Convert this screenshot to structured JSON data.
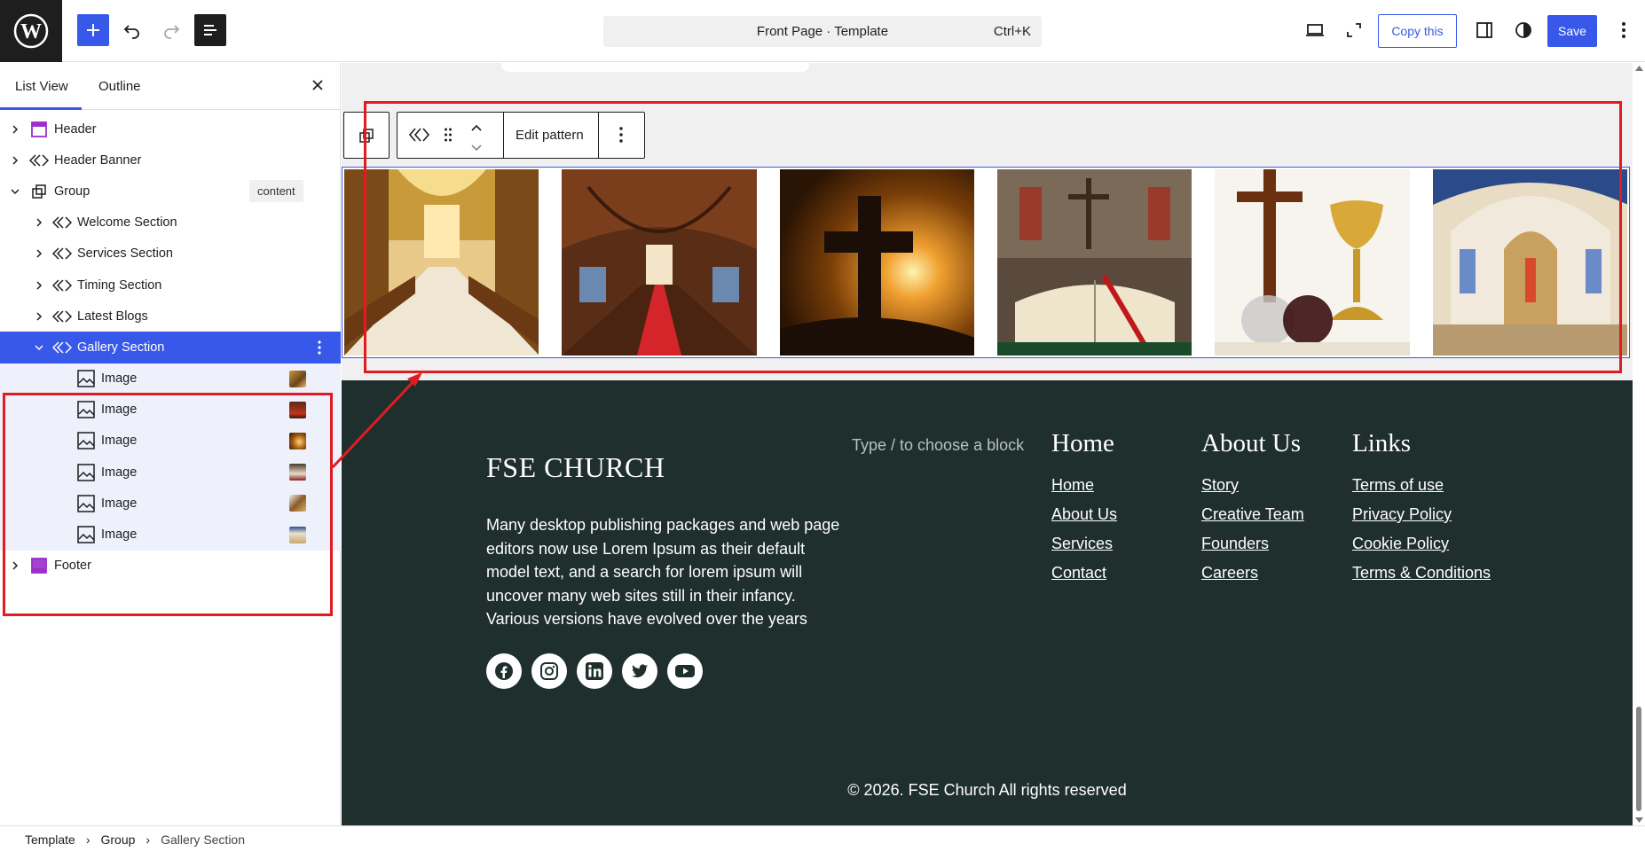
{
  "topbar": {
    "command_title": "Front Page · Template",
    "command_shortcut": "Ctrl+K",
    "copy_label": "Copy this",
    "save_label": "Save"
  },
  "left_panel": {
    "tabs": [
      "List View",
      "Outline"
    ],
    "tree": [
      {
        "label": "Header"
      },
      {
        "label": "Header Banner"
      },
      {
        "label": "Group",
        "badge": "content"
      },
      {
        "label": "Welcome Section"
      },
      {
        "label": "Services Section"
      },
      {
        "label": "Timing Section"
      },
      {
        "label": "Latest Blogs"
      },
      {
        "label": "Gallery Section"
      },
      {
        "label": "Image"
      },
      {
        "label": "Image"
      },
      {
        "label": "Image"
      },
      {
        "label": "Image"
      },
      {
        "label": "Image"
      },
      {
        "label": "Image"
      },
      {
        "label": "Footer"
      }
    ]
  },
  "block_toolbar": {
    "edit_pattern": "Edit pattern"
  },
  "footer": {
    "brand": "FSE CHURCH",
    "description": "Many desktop publishing packages and web page editors now use Lorem Ipsum as their default model text, and a search for lorem ipsum will uncover many web sites still in their infancy. Various versions have evolved over the years",
    "placeholder": "Type / to choose a block",
    "columns": [
      {
        "heading": "Home",
        "links": [
          "Home",
          "About Us",
          "Services",
          "Contact"
        ]
      },
      {
        "heading": "About Us",
        "links": [
          "Story",
          "Creative Team",
          "Founders",
          "Careers"
        ]
      },
      {
        "heading": "Links",
        "links": [
          "Terms of use",
          "Privacy Policy",
          "Cookie Policy",
          "Terms & Conditions"
        ]
      }
    ],
    "copyright": "© 2026. FSE Church All rights reserved"
  },
  "breadcrumb": [
    "Template",
    "Group",
    "Gallery Section"
  ],
  "colors": {
    "accent": "#3858e9",
    "footer_bg": "#1f2f2e",
    "annotation": "#e11b22"
  }
}
